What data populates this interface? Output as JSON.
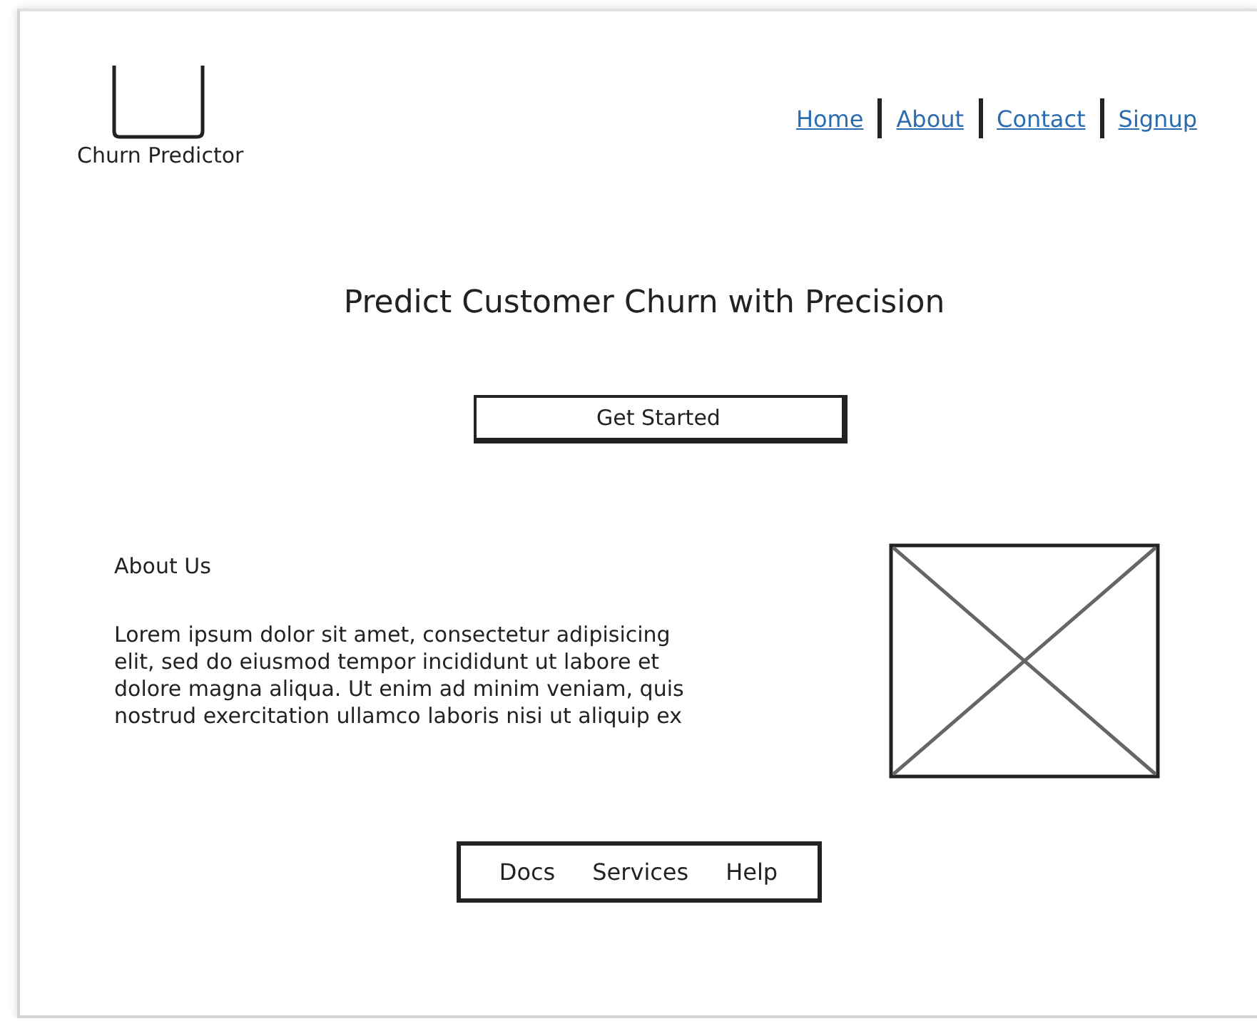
{
  "logo": {
    "text": "Churn Predictor"
  },
  "nav": [
    {
      "label": "Home"
    },
    {
      "label": "About"
    },
    {
      "label": "Contact"
    },
    {
      "label": "Signup"
    }
  ],
  "hero": {
    "title": "Predict Customer Churn with Precision",
    "button": "Get Started"
  },
  "about": {
    "heading": "About Us",
    "text": "Lorem ipsum dolor sit amet, consectetur adipisicing elit, sed do eiusmod tempor incididunt ut labore et dolore magna aliqua. Ut enim ad minim veniam, quis nostrud exercitation ullamco laboris nisi ut aliquip ex",
    "image": {
      "kind": "placeholder"
    }
  },
  "footer": {
    "links": [
      {
        "label": "Docs"
      },
      {
        "label": "Services"
      },
      {
        "label": "Help"
      }
    ]
  }
}
